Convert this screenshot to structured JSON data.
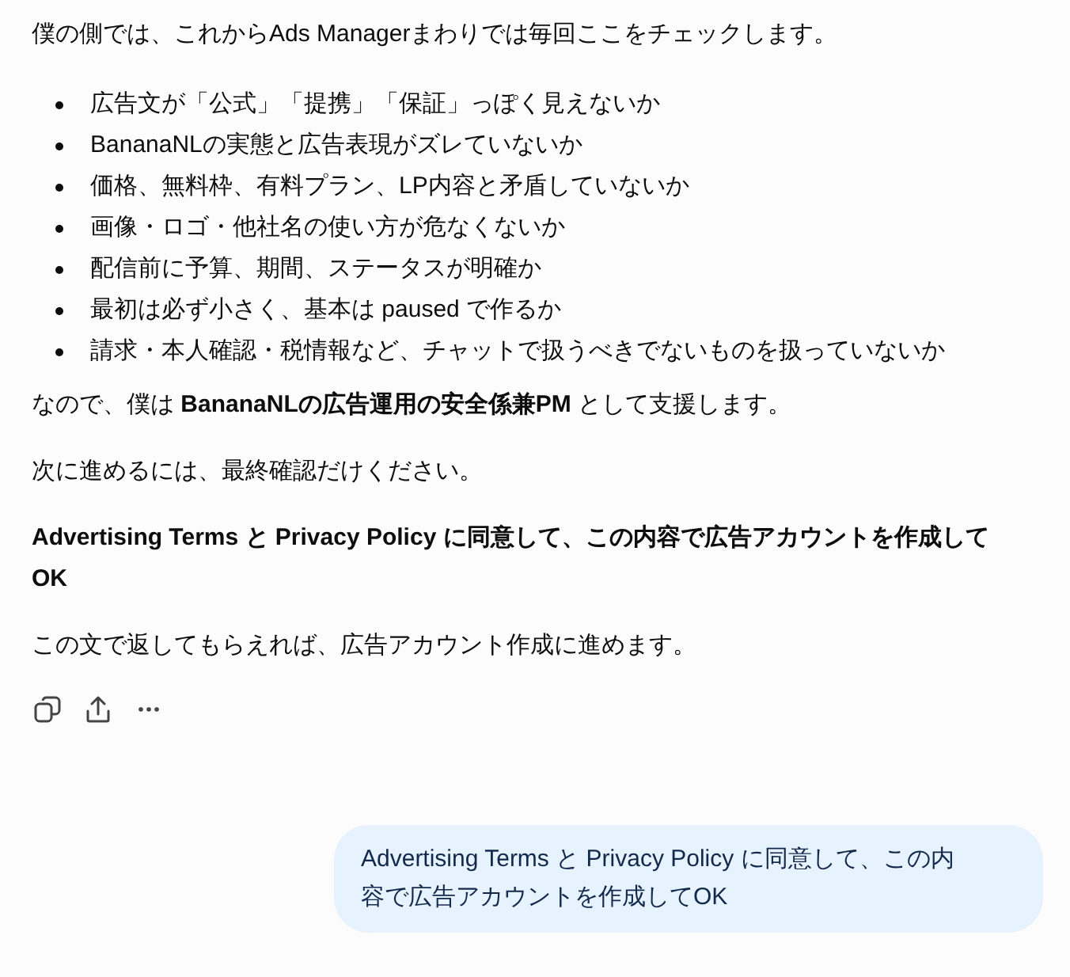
{
  "assistant_message": {
    "intro": "僕の側では、これからAds Managerまわりでは毎回ここをチェックします。",
    "checklist": [
      "広告文が「公式」「提携」「保証」っぽく見えないか",
      "BananaNLの実態と広告表現がズレていないか",
      "価格、無料枠、有料プラン、LP内容と矛盾していないか",
      "画像・ロゴ・他社名の使い方が危なくないか",
      "配信前に予算、期間、ステータスが明確か",
      "最初は必ず小さく、基本は paused で作るか",
      "請求・本人確認・税情報など、チャットで扱うべきでないものを扱っていないか"
    ],
    "paragraphs": [
      {
        "kind": "plain",
        "text": "なので、僕は **BananaNLの広告運用の安全係兼PM** として支援します。"
      },
      {
        "kind": "plain",
        "text": "次に進めるには、最終確認だけください。"
      },
      {
        "kind": "strong",
        "text": "Advertising Terms と Privacy Policy に同意して、この内容で広告アカウントを作成してOK"
      },
      {
        "kind": "plain",
        "text": "この文で返してもらえれば、広告アカウント作成に進めます。"
      }
    ]
  },
  "user_message": {
    "text": "Advertising Terms と Privacy Policy に同意して、この内容で広告アカウントを作成してOK"
  }
}
